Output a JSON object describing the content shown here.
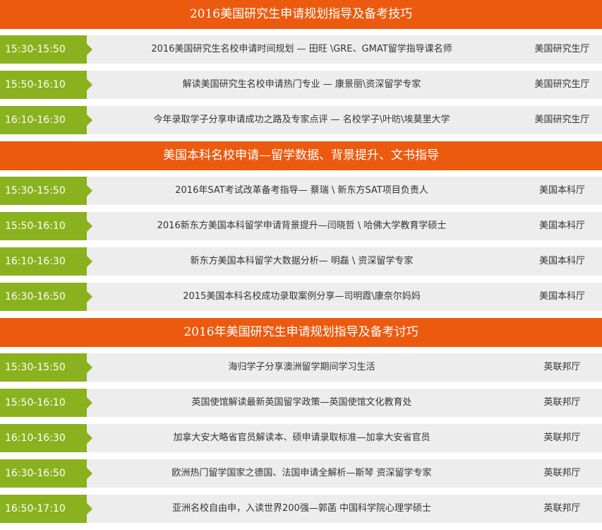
{
  "colors": {
    "section_header_bg": "#ec5a0f",
    "time_bg": "#8ab21e",
    "row_bg": "#ededed",
    "text": "#333333"
  },
  "sections": [
    {
      "title": "2016美国研究生申请规划指导及备考技巧",
      "sessions": [
        {
          "time": "15:30-15:50",
          "topic": "2016美国研究生名校申请时间规划 — 田旺 \\GRE、GMAT留学指导课名师",
          "hall": "美国研究生厅"
        },
        {
          "time": "15:50-16:10",
          "topic": "解读美国研究生名校申请热门专业 — 康景丽\\资深留学专家",
          "hall": "美国研究生厅"
        },
        {
          "time": "16:10-16:30",
          "topic": "今年录取学子分享申请成功之路及专家点评 — 名校学子\\叶昉\\埃莫里大学",
          "hall": "美国研究生厅"
        }
      ]
    },
    {
      "title": "美国本科名校申请—留学数据、背景提升、文书指导",
      "sessions": [
        {
          "time": "15:30-15:50",
          "topic": "2016年SAT考试改革备考指导— 蔡瑞 \\ 新东方SAT项目负责人",
          "hall": "美国本科厅"
        },
        {
          "time": "15:50-16:10",
          "topic": "2016新东方美国本科留学申请背景提升—闫晓哲 \\ 哈佛大学教育学硕士",
          "hall": "美国本科厅"
        },
        {
          "time": "16:10-16:30",
          "topic": "新东方美国本科留学大数据分析— 明磊 \\ 资深留学专家",
          "hall": "美国本科厅"
        },
        {
          "time": "16:30-16:50",
          "topic": "2015美国本科名校成功录取案例分享—司明霞\\康奈尔妈妈",
          "hall": "美国本科厅"
        }
      ]
    },
    {
      "title": "2016年美国研究生申请规划指导及备考讨巧",
      "sessions": [
        {
          "time": "15:30-15:50",
          "topic": "海归学子分享澳洲留学期间学习生活",
          "hall": "英联邦厅"
        },
        {
          "time": "15:50-16:10",
          "topic": "英国使馆解读最新英国留学政策—英国使馆文化教育处",
          "hall": "英联邦厅"
        },
        {
          "time": "16:10-16:30",
          "topic": "加拿大安大略省官员解读本、硕申请录取标准—加拿大安省官员",
          "hall": "英联邦厅"
        },
        {
          "time": "16:30-16:50",
          "topic": "欧洲热门留学国家之德国、法国申请全解析—斯琴 资深留学专家",
          "hall": "英联邦厅"
        },
        {
          "time": "16:50-17:10",
          "topic": "亚洲名校自由申，入读世界200强—郭菡 中国科学院心理学硕士",
          "hall": "英联邦厅"
        }
      ]
    }
  ]
}
